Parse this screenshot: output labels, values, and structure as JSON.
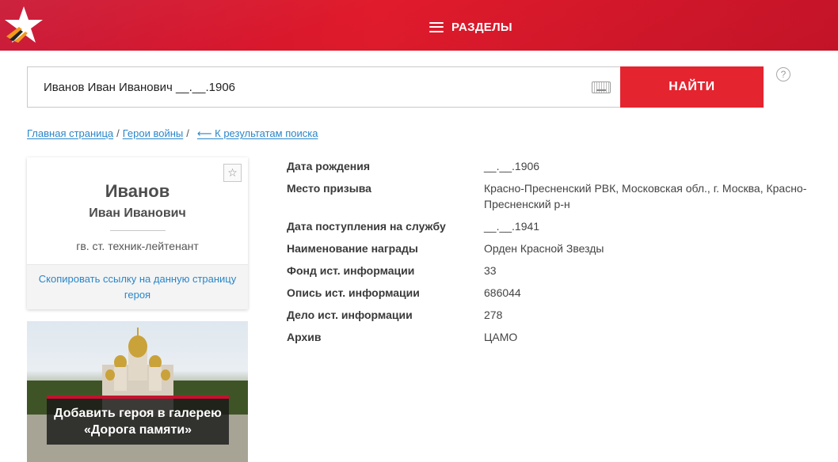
{
  "header": {
    "menu_label": "РАЗДЕЛЫ",
    "brand_color": "#d3152b"
  },
  "search": {
    "value": "Иванов Иван Иванович __.__.1906",
    "button_label": "НАЙТИ",
    "help_glyph": "?",
    "keyboard_icon": "keyboard-icon"
  },
  "breadcrumb": {
    "home": "Главная страница",
    "sep1": "/",
    "heroes": "Герои войны",
    "sep2": "/",
    "back": "⟵ К результатам поиска"
  },
  "hero": {
    "surname": "Иванов",
    "name": "Иван Иванович",
    "rank": "гв. ст. техник-лейтенант",
    "favorite_glyph": "☆",
    "copy_link": "Скопировать ссылку на данную страницу героя"
  },
  "banner": {
    "title": "Добавить героя в галерею «Дорога памяти»"
  },
  "details": [
    {
      "label": "Дата рождения",
      "value": "__.__.1906"
    },
    {
      "label": "Место призыва",
      "value": "Красно-Пресненский РВК, Московская обл., г. Москва, Красно-Пресненский р-н"
    },
    {
      "label": "Дата поступления на службу",
      "value": "__.__.1941"
    },
    {
      "label": "Наименование награды",
      "value": "Орден Красной Звезды"
    },
    {
      "label": "Фонд ист. информации",
      "value": "33"
    },
    {
      "label": "Опись ист. информации",
      "value": "686044"
    },
    {
      "label": "Дело ист. информации",
      "value": "278"
    },
    {
      "label": "Архив",
      "value": "ЦАМО"
    }
  ]
}
